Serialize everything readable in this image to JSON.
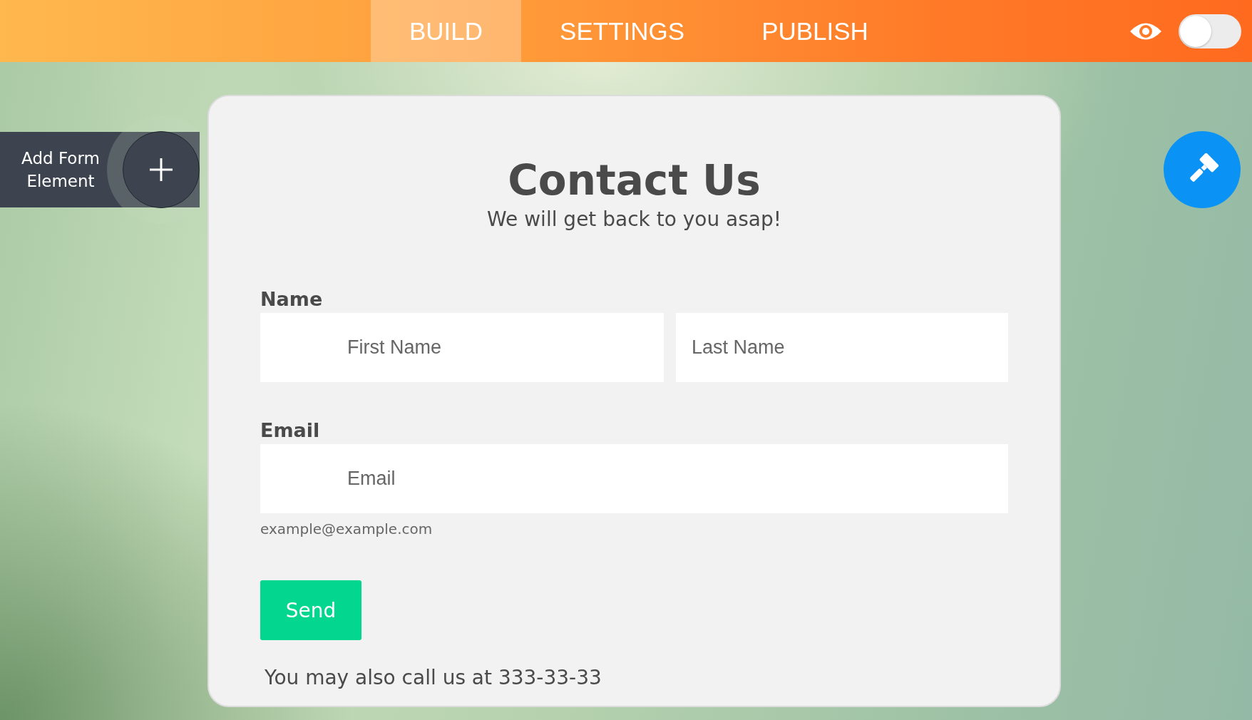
{
  "tabs": [
    {
      "label": "BUILD",
      "selected": true
    },
    {
      "label": "SETTINGS",
      "selected": false
    },
    {
      "label": "PUBLISH",
      "selected": false
    }
  ],
  "preview_toggle": {
    "on": false
  },
  "add_element": {
    "label": "Add Form Element"
  },
  "form": {
    "title": "Contact Us",
    "subtitle": "We will get back to you asap!",
    "fields": [
      {
        "label": "Name",
        "inputs": [
          {
            "placeholder": "First Name",
            "indented": true
          },
          {
            "placeholder": "Last Name",
            "indented": false
          }
        ]
      },
      {
        "label": "Email",
        "inputs": [
          {
            "placeholder": "Email",
            "indented": true
          }
        ],
        "hint": "example@example.com"
      }
    ],
    "submit": "Send",
    "footer": "You may also call us at 333-33-33"
  }
}
